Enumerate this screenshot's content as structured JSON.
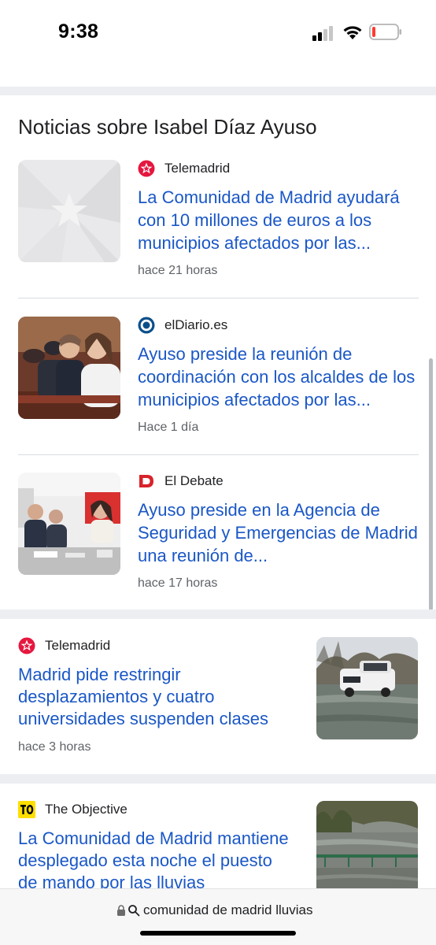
{
  "status_bar": {
    "time": "9:38"
  },
  "top_stories": {
    "title": "Noticias sobre Isabel Díaz Ayuso",
    "items": [
      {
        "source": "Telemadrid",
        "source_icon": "telemadrid-star-logo",
        "headline": "La Comunidad de Madrid ayudará con 10 millones de euros a los municipios afectados por las...",
        "time": "hace 21 horas",
        "thumbnail": "placeholder-star-thumbnail"
      },
      {
        "source": "elDiario.es",
        "source_icon": "eldiario-circle-logo",
        "headline": "Ayuso preside la reunión de coordinación con los alcaldes de los municipios afectados por las...",
        "time": "Hace 1 día",
        "thumbnail": "meeting-photo-thumbnail"
      },
      {
        "source": "El Debate",
        "source_icon": "eldebate-d-logo",
        "headline": "Ayuso preside en la Agencia de Seguridad y Emergencias de Madrid una reunión de...",
        "time": "hace 17 horas",
        "thumbnail": "emergency-meeting-photo-thumbnail"
      }
    ]
  },
  "cards": [
    {
      "source": "Telemadrid",
      "source_icon": "telemadrid-star-logo",
      "headline": "Madrid pide restringir desplazamientos y cuatro universidades suspenden clases",
      "time": "hace 3 horas",
      "thumbnail": "flooded-road-truck-photo"
    },
    {
      "source": "The Objective",
      "source_icon": "theobjective-to-logo",
      "headline": "La Comunidad de Madrid mantiene desplegado esta noche el puesto de mando por las lluvias",
      "thumbnail": "flooded-river-bridge-photo"
    }
  ],
  "url_bar": {
    "text": "comunidad de madrid lluvias"
  },
  "colors": {
    "link_blue": "#1a57c6",
    "telemadrid_red": "#e5173f",
    "eldiario_blue": "#0b4f8a",
    "eldebate_red": "#d8232a",
    "theobjective_yellow": "#ffde00"
  }
}
